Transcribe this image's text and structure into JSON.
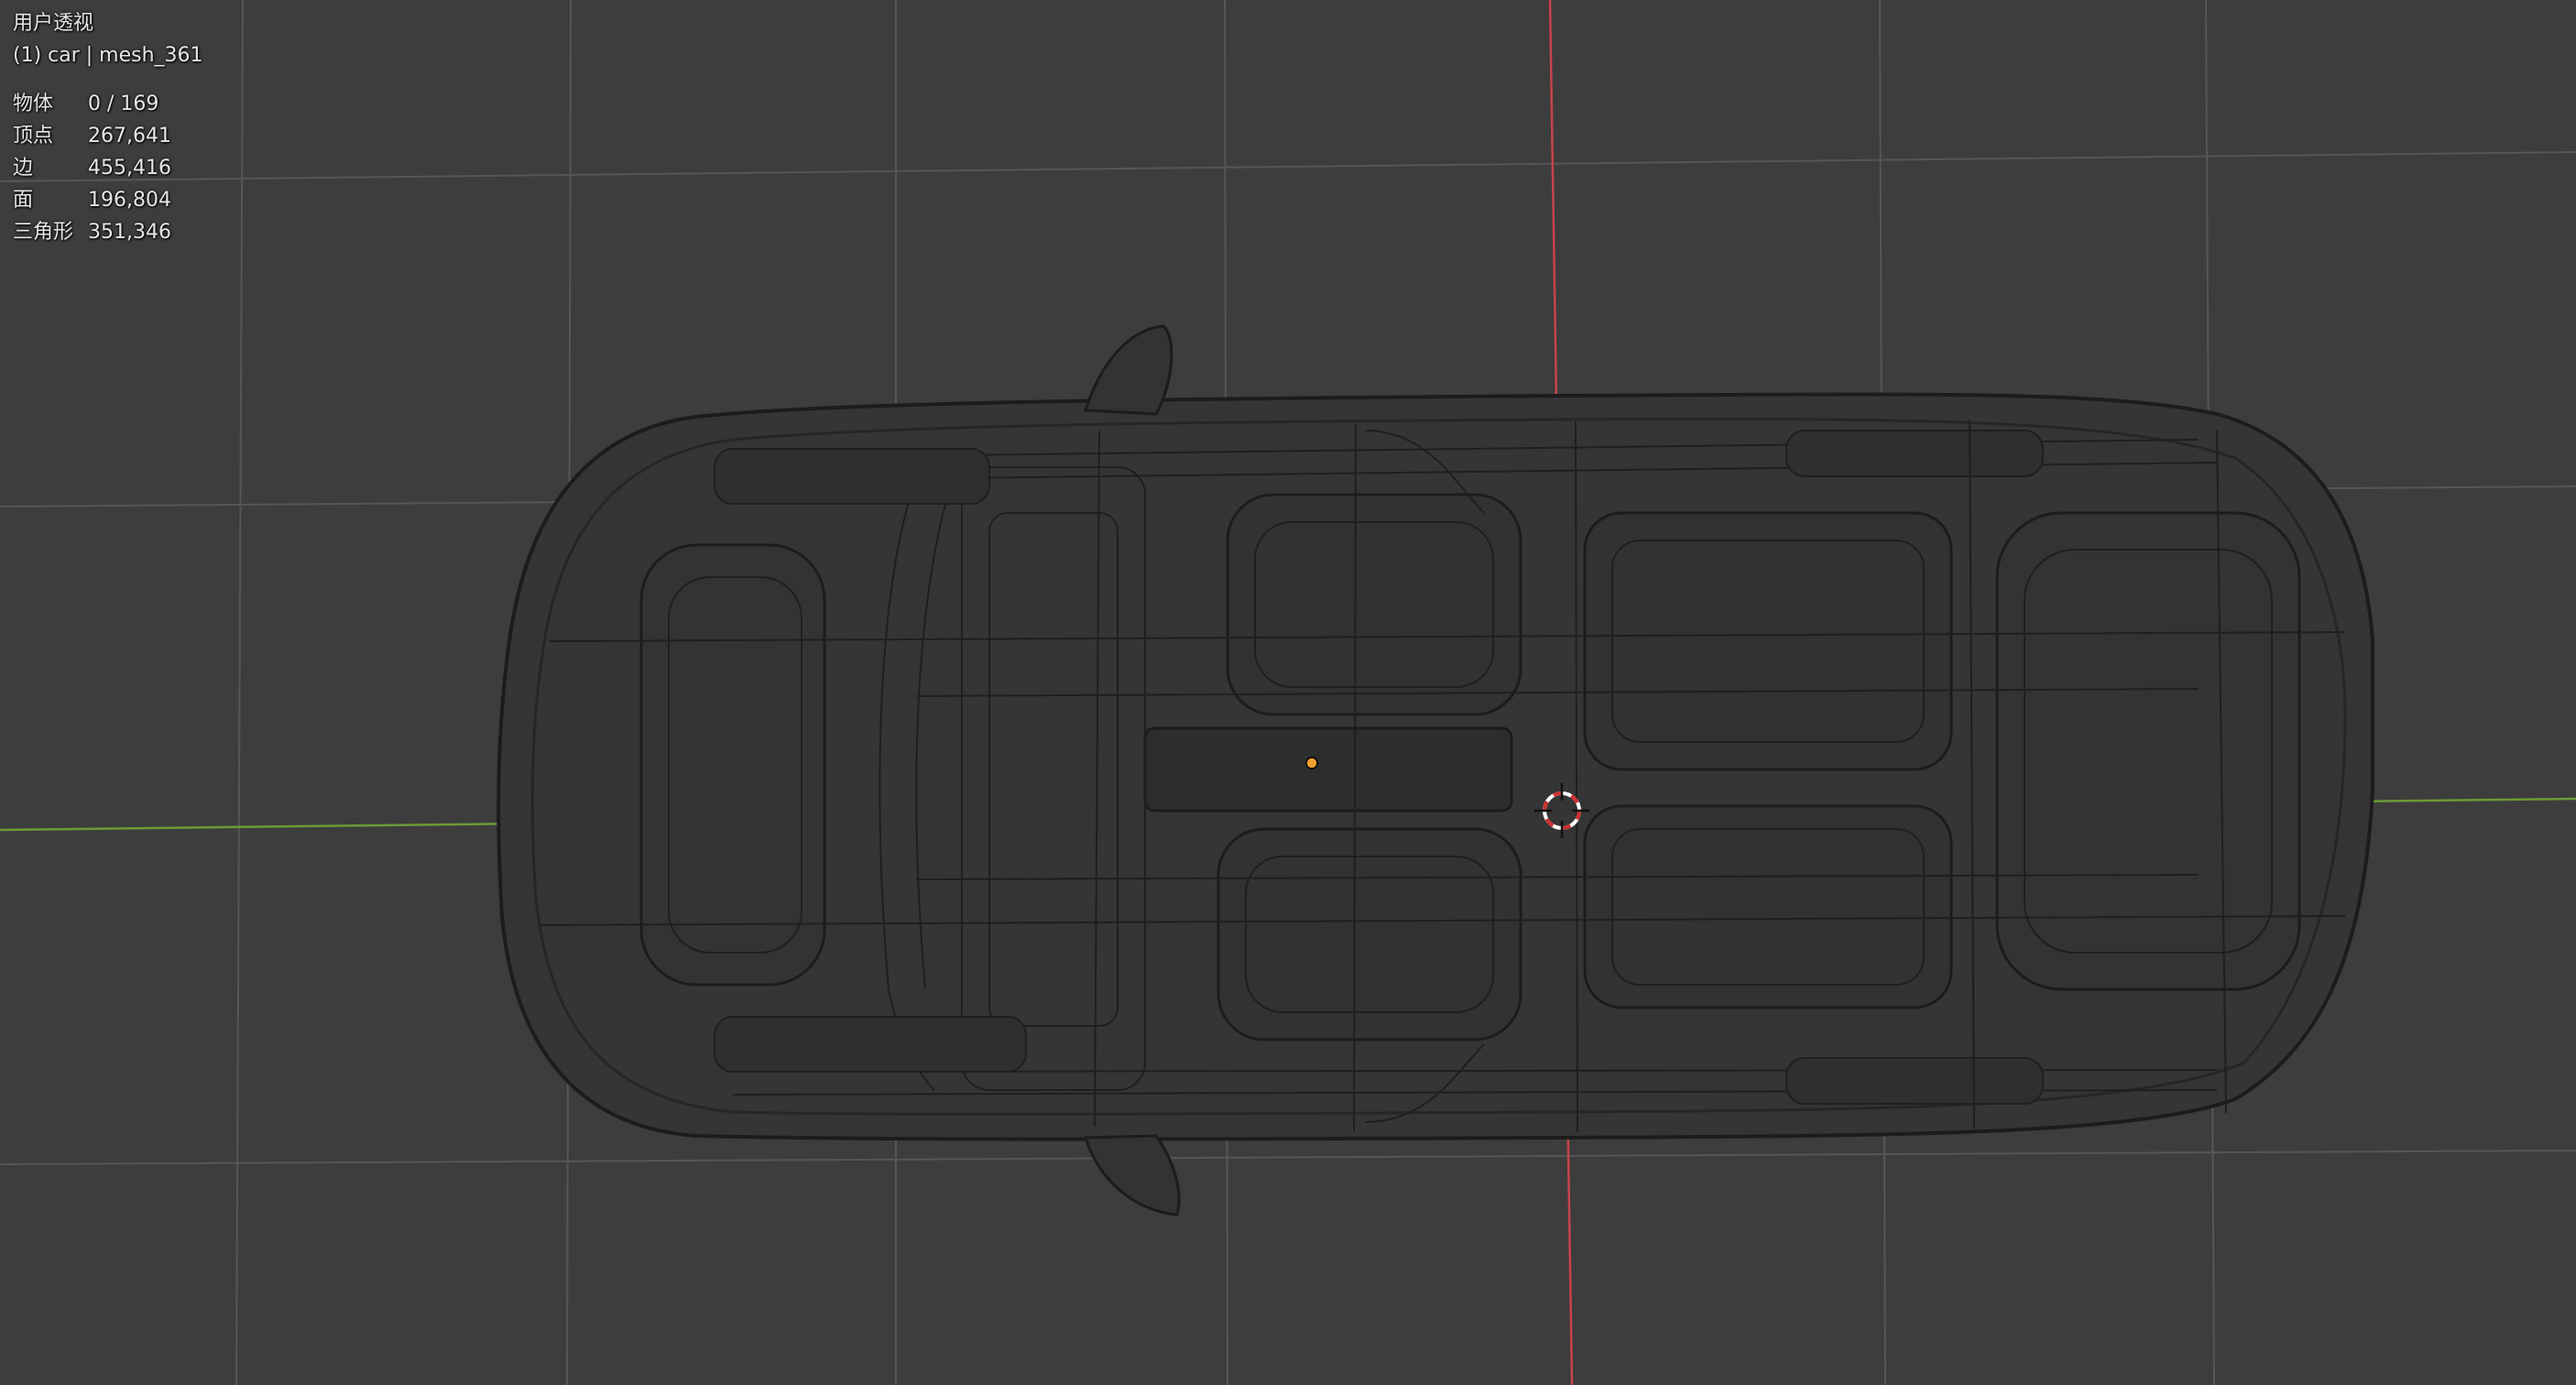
{
  "viewport": {
    "view_name": "用户透视",
    "object_info": "(1) car | mesh_361",
    "stats": [
      {
        "label": "物体",
        "value": "0 / 169"
      },
      {
        "label": "顶点",
        "value": "267,641"
      },
      {
        "label": "边",
        "value": "455,416"
      },
      {
        "label": "面",
        "value": "196,804"
      },
      {
        "label": "三角形",
        "value": "351,346"
      }
    ]
  },
  "colors": {
    "background": "#3d3d3d",
    "grid": "#565656",
    "x_axis": "#c8434b",
    "y_axis": "#6d9a36",
    "wire": "#1c1c1c",
    "origin": "#f0a030",
    "cursor": "#d03030"
  },
  "icons": [
    "3d-cursor-icon",
    "object-origin-icon"
  ]
}
